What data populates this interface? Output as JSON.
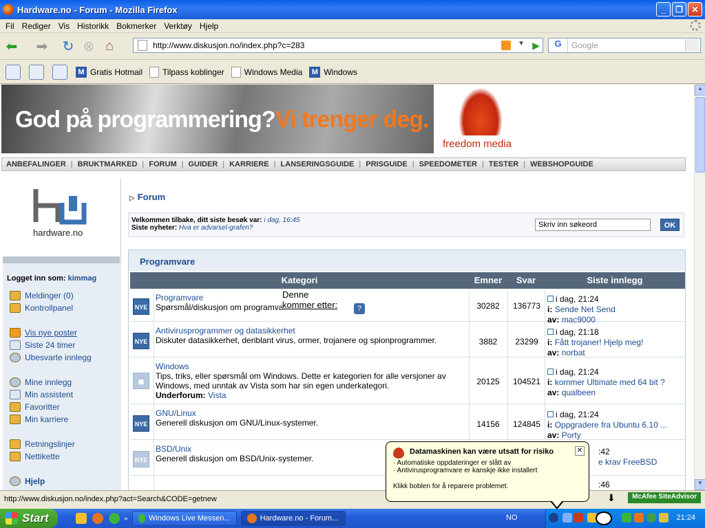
{
  "window": {
    "title": "Hardware.no - Forum - Mozilla Firefox"
  },
  "menu": [
    "Fil",
    "Rediger",
    "Vis",
    "Historikk",
    "Bokmerker",
    "Verktøy",
    "Hjelp"
  ],
  "address": {
    "url": "http://www.diskusjon.no/index.php?c=283"
  },
  "search": {
    "engine_badge": "G",
    "placeholder": "Google"
  },
  "bookmarks": [
    "Gratis Hotmail",
    "Tilpass koblinger",
    "Windows Media",
    "Windows"
  ],
  "banner": {
    "line1": "God på programmering?",
    "line2": "Vi trenger deg.",
    "sponsor": "freedom media"
  },
  "site_nav": [
    "ANBEFALINGER",
    "BRUKTMARKED",
    "FORUM",
    "GUIDER",
    "KARRIERE",
    "LANSERINGSGUIDE",
    "PRISGUIDE",
    "SPEEDOMETER",
    "TESTER",
    "WEBSHOPGUIDE"
  ],
  "logo": {
    "text": "hardware.no"
  },
  "sidebar": {
    "logged_in_label": "Logget inn som:",
    "username": "kimmag",
    "links": [
      "Meldinger (0)",
      "Kontrollpanel",
      "Vis nye poster",
      "Siste 24 timer",
      "Ubesvarte innlegg",
      "Mine innlegg",
      "Min assistent",
      "Favoritter",
      "Min karriere",
      "Retningslinjer",
      "Nettikette",
      "Hjelp"
    ]
  },
  "breadcrumb": "Forum",
  "welcome": {
    "text": "Velkommen tilbake, ditt siste besøk var:",
    "last_visit": "i dag, 16:45",
    "news_label": "Siste nyheter:",
    "news_link": "Hva er advarsel-grafen?",
    "search_placeholder": "Skriv inn søkeord",
    "ok": "OK"
  },
  "section": {
    "title": "Programvare",
    "headers": {
      "category": "Kategori",
      "topics": "Emner",
      "replies": "Svar",
      "last": "Siste innlegg"
    },
    "rows": [
      {
        "badge": "NYE",
        "title": "Programvare",
        "desc": "Spørsmål/diskusjon om programvare.",
        "topics": "30282",
        "replies": "136773",
        "time": "i dag, 21:24",
        "i_label": "i:",
        "topic": "Sende Net Send",
        "av_label": "av:",
        "user": "mac9000"
      },
      {
        "badge": "NYE",
        "title": "Antivirusprogrammer og datasikkerhet",
        "desc": "Diskuter datasikkerhet, deriblant virus, ormer, trojanere og spionprogrammer.",
        "topics": "3882",
        "replies": "23299",
        "time": "i dag, 21:18",
        "i_label": "i:",
        "topic": "Fått trojaner! Hjelp meg!",
        "av_label": "av:",
        "user": "norbat"
      },
      {
        "badge": "",
        "title": "Windows",
        "desc": "Tips, triks, eller spørsmål om Windows. Dette er kategorien for alle versjoner av Windows, med unntak av Vista som har sin egen underkategori.",
        "sub_label": "Underforum:",
        "sub_link": "Vista",
        "topics": "20125",
        "replies": "104521",
        "time": "i dag, 21:24",
        "i_label": "i:",
        "topic": "kommer Ultimate med 64 bit ?",
        "av_label": "av:",
        "user": "qualbeen"
      },
      {
        "badge": "NYE",
        "title": "GNU/Linux",
        "desc": "Generell diskusjon om GNU/Linux-systemer.",
        "topics": "14156",
        "replies": "124845",
        "time": "i dag, 21:24",
        "i_label": "i:",
        "topic": "Oppgradere fra Ubuntu 6.10 ...",
        "av_label": "av:",
        "user": "Porty"
      },
      {
        "badge": "NYE",
        "title": "BSD/Unix",
        "desc": "Generell diskusjon om BSD/Unix-systemer.",
        "topics": "",
        "replies": "",
        "time": ":42",
        "i_label": "",
        "topic": "e krav FreeBSD",
        "av_label": "",
        "user": ""
      }
    ],
    "row_extra_time": ":46"
  },
  "tooltip": {
    "line1": "Denne",
    "line2": "kommer etter:"
  },
  "status": {
    "url": "http://www.diskusjon.no/index.php?act=Search&CODE=getnew",
    "mcafee": "McAfee SiteAdvisor"
  },
  "balloon": {
    "title": "Datamaskinen kan være utsatt for risiko",
    "line1": "· Automatiske oppdateringer er slått av",
    "line2": "· Antivirusprogramvare er kanskje ikke installert",
    "line3": "Klikk boblen for å reparere problemet."
  },
  "taskbar": {
    "start": "Start",
    "tasks": [
      "Windows Live Messen...",
      "Hardware.no - Forum..."
    ],
    "lang": "NO",
    "clock": "21:24"
  }
}
